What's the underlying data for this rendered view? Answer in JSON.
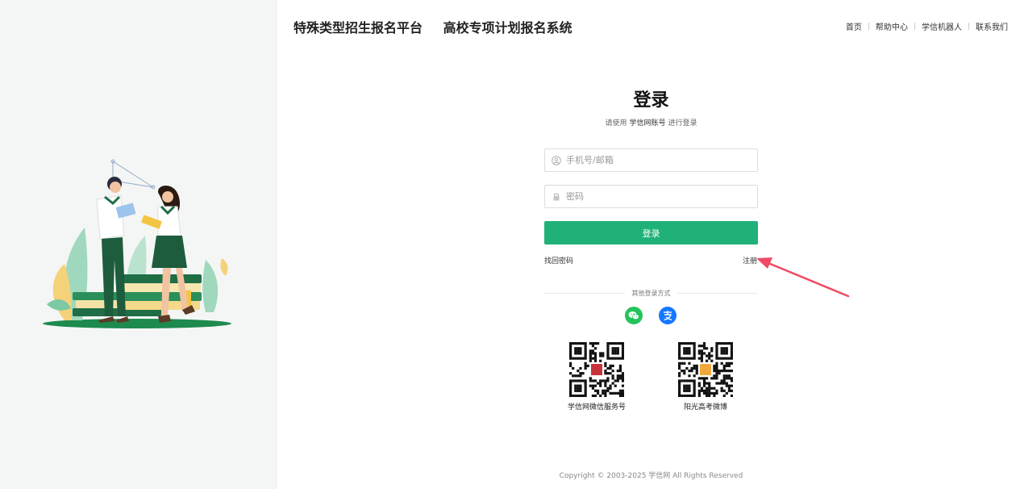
{
  "header": {
    "platform_title": "特殊类型招生报名平台",
    "system_title": "高校专项计划报名系统"
  },
  "nav": {
    "items": [
      "首页",
      "帮助中心",
      "学信机器人",
      "联系我们"
    ]
  },
  "login": {
    "title": "登录",
    "subtitle_prefix": "请使用",
    "subtitle_account": "学信网账号",
    "subtitle_suffix": "进行登录",
    "username_placeholder": "手机号/邮箱",
    "password_placeholder": "密码",
    "submit_label": "登录",
    "forgot_label": "找回密码",
    "register_label": "注册"
  },
  "other_login": {
    "label": "其他登录方式",
    "methods": [
      "wechat-icon",
      "alipay-icon"
    ]
  },
  "qrcodes": [
    {
      "label": "学信网微信服务号"
    },
    {
      "label": "阳光高考微博"
    }
  ],
  "footer": {
    "copyright": "Copyright © 2003-2025  学信网  All Rights Reserved"
  },
  "colors": {
    "primary": "#20b178",
    "wechat": "#22c35b",
    "alipay": "#1677ff",
    "arrow": "#ee4b63"
  }
}
